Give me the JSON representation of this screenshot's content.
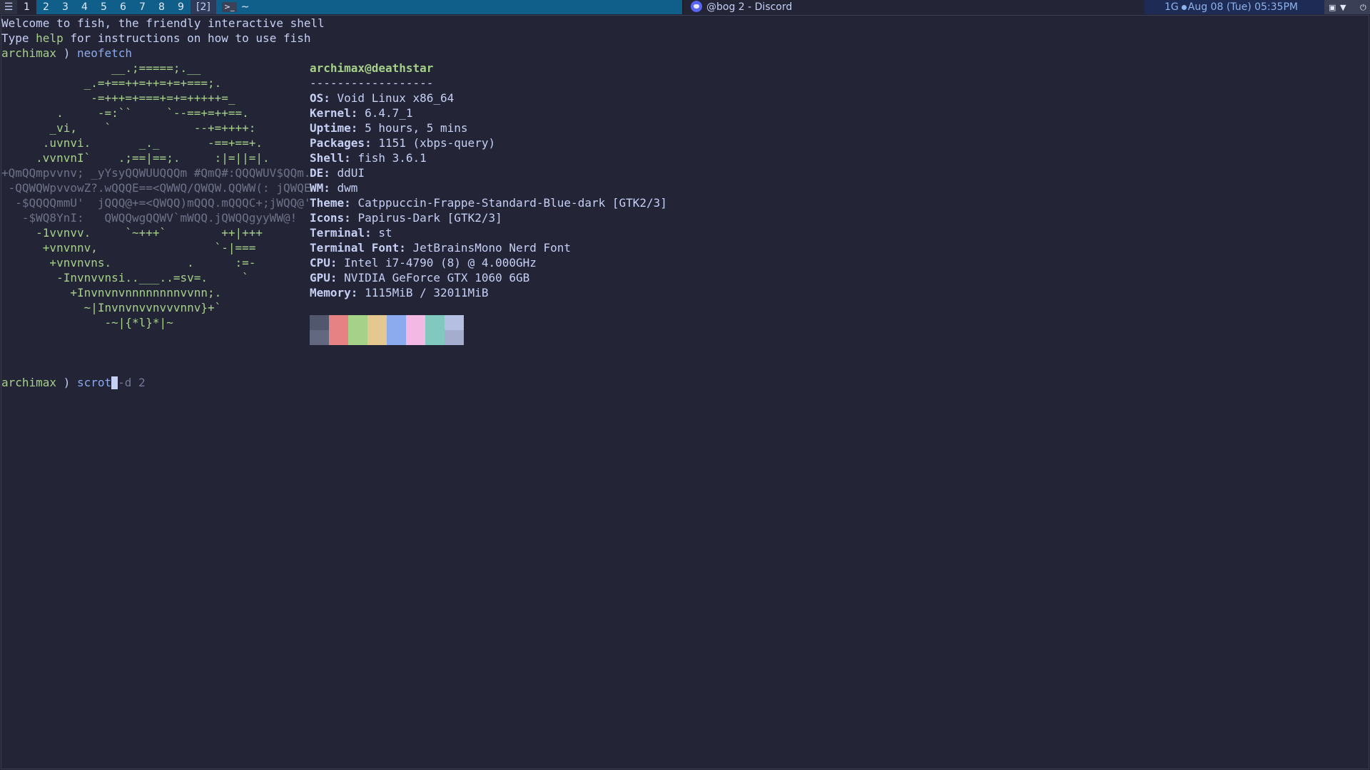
{
  "topbar": {
    "tags": [
      "1",
      "2",
      "3",
      "4",
      "5",
      "6",
      "7",
      "8",
      "9"
    ],
    "selected_tag": "1",
    "layout": "[2]",
    "terminal_label": "~",
    "window_title": "@bog 2 - Discord",
    "mem": "1G",
    "datetime": "Aug 08 (Tue) 05:35PM"
  },
  "terminal": {
    "welcome": "Welcome to fish, the friendly interactive shell",
    "help_pre": "Type ",
    "help_word": "help",
    "help_post": " for instructions on how to use fish",
    "prompt_user": "archimax",
    "prompt_sep": ")",
    "command1": "neofetch",
    "command2": "scrot",
    "autosuggest": "-d 2"
  },
  "neofetch": {
    "userhost": "archimax@deathstar",
    "separator": "------------------",
    "fields": [
      {
        "key": "OS",
        "value": "Void Linux x86_64"
      },
      {
        "key": "Kernel",
        "value": "6.4.7_1"
      },
      {
        "key": "Uptime",
        "value": "5 hours, 5 mins"
      },
      {
        "key": "Packages",
        "value": "1151 (xbps-query)"
      },
      {
        "key": "Shell",
        "value": "fish 3.6.1"
      },
      {
        "key": "DE",
        "value": "ddUI"
      },
      {
        "key": "WM",
        "value": "dwm"
      },
      {
        "key": "Theme",
        "value": "Catppuccin-Frappe-Standard-Blue-dark [GTK2/3]"
      },
      {
        "key": "Icons",
        "value": "Papirus-Dark [GTK2/3]"
      },
      {
        "key": "Terminal",
        "value": "st"
      },
      {
        "key": "Terminal Font",
        "value": "JetBrainsMono Nerd Font"
      },
      {
        "key": "CPU",
        "value": "Intel i7-4790 (8) @ 4.000GHz"
      },
      {
        "key": "GPU",
        "value": "NVIDIA GeForce GTX 1060 6GB"
      },
      {
        "key": "Memory",
        "value": "1115MiB / 32011MiB"
      }
    ],
    "palette_top": [
      "#51576d",
      "#e78284",
      "#a6d189",
      "#e5c890",
      "#8caaee",
      "#f4b8e4",
      "#81c8be",
      "#b5bfe2"
    ],
    "palette_bottom": [
      "#626880",
      "#e78284",
      "#a6d189",
      "#e5c890",
      "#8caaee",
      "#f4b8e4",
      "#81c8be",
      "#a5adce"
    ],
    "logo": [
      "                __.;=====;.__",
      "            _.=+==++=++=+=+===;.",
      "             -=+++=+===+=+=+++++=_",
      "        .     -=:``     `--==+=++==.",
      "       _vi,    `            --+=++++:",
      "      .uvnvi.       _._       -==+==+.",
      "     .vvnvnI`    .;==|==;.     :|=||=|.",
      "+QmQQmpvvnv; _yYsyQQWUUQQQm #QmQ#:QQQWUV$QQm.",
      " -QQWQWpvvowZ?.wQQQE==<QWWQ/QWQW.QQWW(: jQWQE",
      "  -$QQQQmmU'  jQQQ@+=<QWQQ)mQQQ.mQQQC+;jWQQ@'",
      "   -$WQ8YnI:   QWQQwgQQWV`mWQQ.jQWQQgyyWW@!",
      "     -1vvnvv.     `~+++`        ++|+++",
      "      +vnvnnv,                 `-|===",
      "       +vnvnvns.           .      :=-",
      "        -Invnvvnsi..___..=sv=.     `",
      "          +Invnvnvnnnnnnnnvvnn;.",
      "            ~|Invnvnvvnvvvnnv}+`",
      "               -~|{*l}*|~"
    ]
  }
}
